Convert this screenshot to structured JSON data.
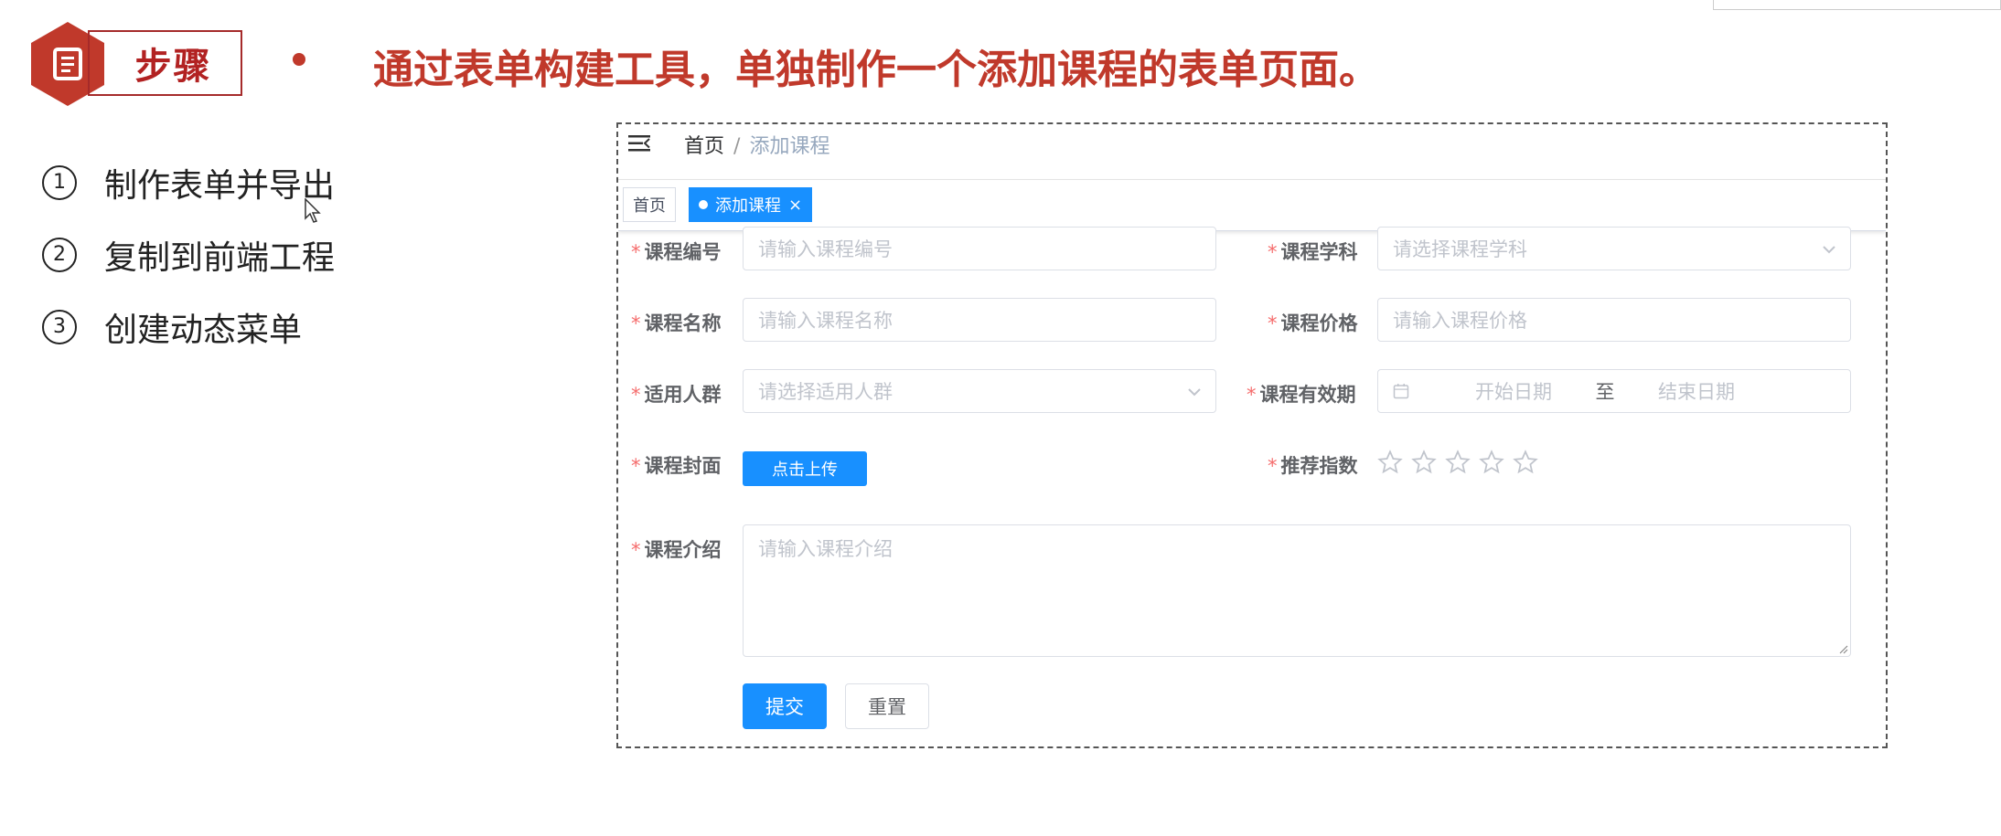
{
  "slide": {
    "badge_icon": "document-icon",
    "step_label": "步骤",
    "title": "通过表单构建工具，单独制作一个添加课程的表单页面。",
    "steps": [
      {
        "num": "①",
        "text": "制作表单并导出"
      },
      {
        "num": "②",
        "text": "复制到前端工程"
      },
      {
        "num": "③",
        "text": "创建动态菜单"
      }
    ]
  },
  "app": {
    "breadcrumb": {
      "home": "首页",
      "separator": "/",
      "current": "添加课程"
    },
    "tags": [
      {
        "label": "首页",
        "active": false
      },
      {
        "label": "添加课程",
        "active": true,
        "close": "×"
      }
    ],
    "form": {
      "required_mark": "*",
      "course_no": {
        "label": "课程编号",
        "placeholder": "请输入课程编号"
      },
      "course_subject": {
        "label": "课程学科",
        "placeholder": "请选择课程学科"
      },
      "course_name": {
        "label": "课程名称",
        "placeholder": "请输入课程名称"
      },
      "course_price": {
        "label": "课程价格",
        "placeholder": "请输入课程价格"
      },
      "audience": {
        "label": "适用人群",
        "placeholder": "请选择适用人群"
      },
      "validity": {
        "label": "课程有效期",
        "start_placeholder": "开始日期",
        "range_separator": "至",
        "end_placeholder": "结束日期"
      },
      "cover": {
        "label": "课程封面",
        "upload_label": "点击上传"
      },
      "rating": {
        "label": "推荐指数",
        "value": 0,
        "max": 5
      },
      "intro": {
        "label": "课程介绍",
        "placeholder": "请输入课程介绍"
      },
      "submit_label": "提交",
      "reset_label": "重置"
    },
    "colors": {
      "primary": "#1890ff",
      "required": "#f56c6c",
      "title_red": "#c0392b"
    }
  }
}
